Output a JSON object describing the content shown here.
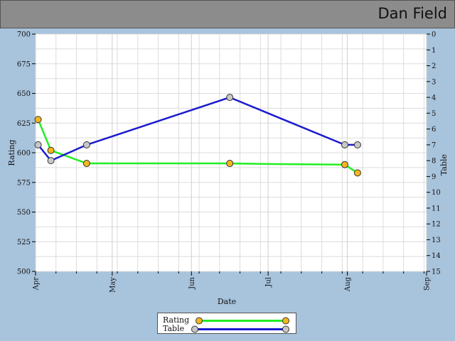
{
  "header": {
    "title": "Dan Field"
  },
  "chart_data": {
    "type": "line",
    "xlabel": "Date",
    "ylabel_left": "Rating",
    "ylabel_right": "Table",
    "x_ticks": [
      "Apr",
      "May",
      "Jun",
      "Jul",
      "Aug",
      "Sep"
    ],
    "x_tick_dates": [
      "04-01",
      "05-01",
      "06-01",
      "07-01",
      "08-01",
      "09-01"
    ],
    "x_range": [
      "04-01",
      "09-01"
    ],
    "y_left": {
      "min": 500,
      "max": 700,
      "step": 25
    },
    "y_right": {
      "min": 0,
      "max": 15,
      "step": 1,
      "inverted": true
    },
    "grid": true,
    "legend_position": "bottom-center",
    "series": [
      {
        "name": "Rating",
        "axis": "left",
        "color": "#22ee22",
        "marker_color": "#f5b51c",
        "points": [
          {
            "x": "04-02",
            "y": 628,
            "marker": true
          },
          {
            "x": "04-07",
            "y": 602,
            "marker": true
          },
          {
            "x": "04-21",
            "y": 591,
            "marker": true
          },
          {
            "x": "06-16",
            "y": 591,
            "marker": true
          },
          {
            "x": "07-01",
            "y": 590.5,
            "marker": false
          },
          {
            "x": "07-31",
            "y": 590,
            "marker": true
          },
          {
            "x": "08-05",
            "y": 583,
            "marker": true
          }
        ]
      },
      {
        "name": "Table",
        "axis": "right",
        "color": "#1a1ad0",
        "marker_color": "#c8c8c8",
        "points": [
          {
            "x": "04-02",
            "y": 7,
            "marker": true
          },
          {
            "x": "04-07",
            "y": 8,
            "marker": true
          },
          {
            "x": "04-21",
            "y": 7,
            "marker": true
          },
          {
            "x": "06-16",
            "y": 4,
            "marker": true
          },
          {
            "x": "07-31",
            "y": 7,
            "marker": true
          },
          {
            "x": "08-05",
            "y": 7,
            "marker": true
          }
        ]
      }
    ]
  }
}
